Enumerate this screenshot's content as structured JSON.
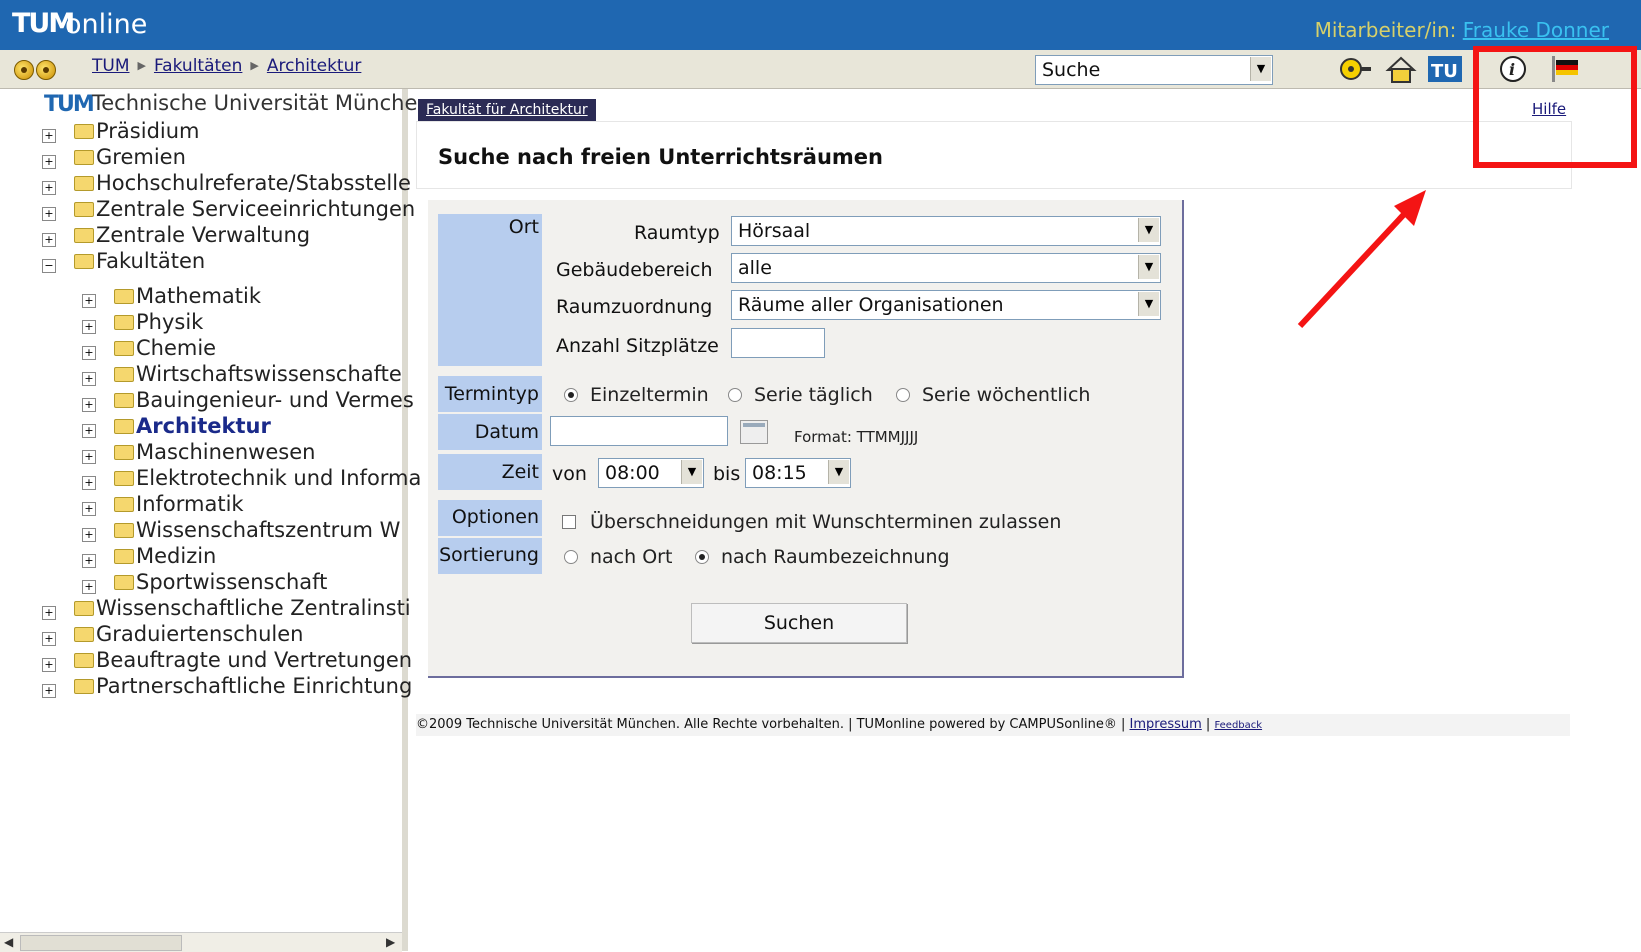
{
  "header": {
    "logo": "TUM",
    "app_name": "online",
    "user_label": "Mitarbeiter/in:",
    "user_name": "Frauke Donner"
  },
  "breadcrumb": [
    "TUM",
    "Fakultäten",
    "Architektur"
  ],
  "search_select": {
    "value": "Suche"
  },
  "toolbar_icons": [
    "key-icon",
    "home-icon",
    "tum-logo-icon",
    "info-icon",
    "language-flag-icon"
  ],
  "tree": {
    "root": "Technische Universität Münche",
    "items": [
      {
        "label": "Präsidium",
        "expander": "+"
      },
      {
        "label": "Gremien",
        "expander": "+"
      },
      {
        "label": "Hochschulreferate/Stabsstelle",
        "expander": "+"
      },
      {
        "label": "Zentrale Serviceeinrichtungen",
        "expander": "+"
      },
      {
        "label": "Zentrale Verwaltung",
        "expander": "+"
      },
      {
        "label": "Fakultäten",
        "expander": "−"
      }
    ],
    "faculties": [
      "Mathematik",
      "Physik",
      "Chemie",
      "Wirtschaftswissenschafte",
      "Bauingenieur- und Vermes",
      "Architektur",
      "Maschinenwesen",
      "Elektrotechnik und Informa",
      "Informatik",
      "Wissenschaftszentrum W",
      "Medizin",
      "Sportwissenschaft"
    ],
    "items_after": [
      {
        "label": "Wissenschaftliche Zentralinsti",
        "expander": "+"
      },
      {
        "label": "Graduiertenschulen",
        "expander": "+"
      },
      {
        "label": "Beauftragte und Vertretungen",
        "expander": "+"
      },
      {
        "label": "Partnerschaftliche Einrichtung",
        "expander": "+"
      }
    ]
  },
  "main": {
    "faculty_tab": "Fakultät für Architektur",
    "help": "Hilfe",
    "title": "Suche nach freien Unterrichtsräumen",
    "form": {
      "sections": {
        "ort": "Ort",
        "termintyp": "Termintyp",
        "datum": "Datum",
        "zeit": "Zeit",
        "optionen": "Optionen",
        "sortierung": "Sortierung"
      },
      "raumtyp_label": "Raumtyp",
      "raumtyp_value": "Hörsaal",
      "gebaeude_label": "Gebäudebereich",
      "gebaeude_value": "alle",
      "raumzuordnung_label": "Raumzuordnung",
      "raumzuordnung_value": "Räume aller Organisationen",
      "sitzplaetze_label": "Anzahl Sitzplätze",
      "sitzplaetze_value": "",
      "termintyp_options": [
        "Einzeltermin",
        "Serie täglich",
        "Serie wöchentlich"
      ],
      "termintyp_selected": "Einzeltermin",
      "datum_value": "",
      "format_hint": "Format: TTMMJJJJ",
      "zeit_von_label": "von",
      "zeit_von": "08:00",
      "zeit_bis_label": "bis",
      "zeit_bis": "08:15",
      "option_overlap": "Überschneidungen mit Wunschterminen zulassen",
      "sort_options": [
        "nach Ort",
        "nach Raumbezeichnung"
      ],
      "sort_selected": "nach Raumbezeichnung",
      "submit": "Suchen"
    },
    "footer": {
      "text": "©2009 Technische Universität München. Alle Rechte vorbehalten. | TUMonline powered by CAMPUSonline® | ",
      "impressum": "Impressum",
      "feedback": "Feedback"
    }
  },
  "colors": {
    "topbar": "#1f67b1",
    "section_bg": "#b7cdee",
    "annotation": "#f41414"
  }
}
